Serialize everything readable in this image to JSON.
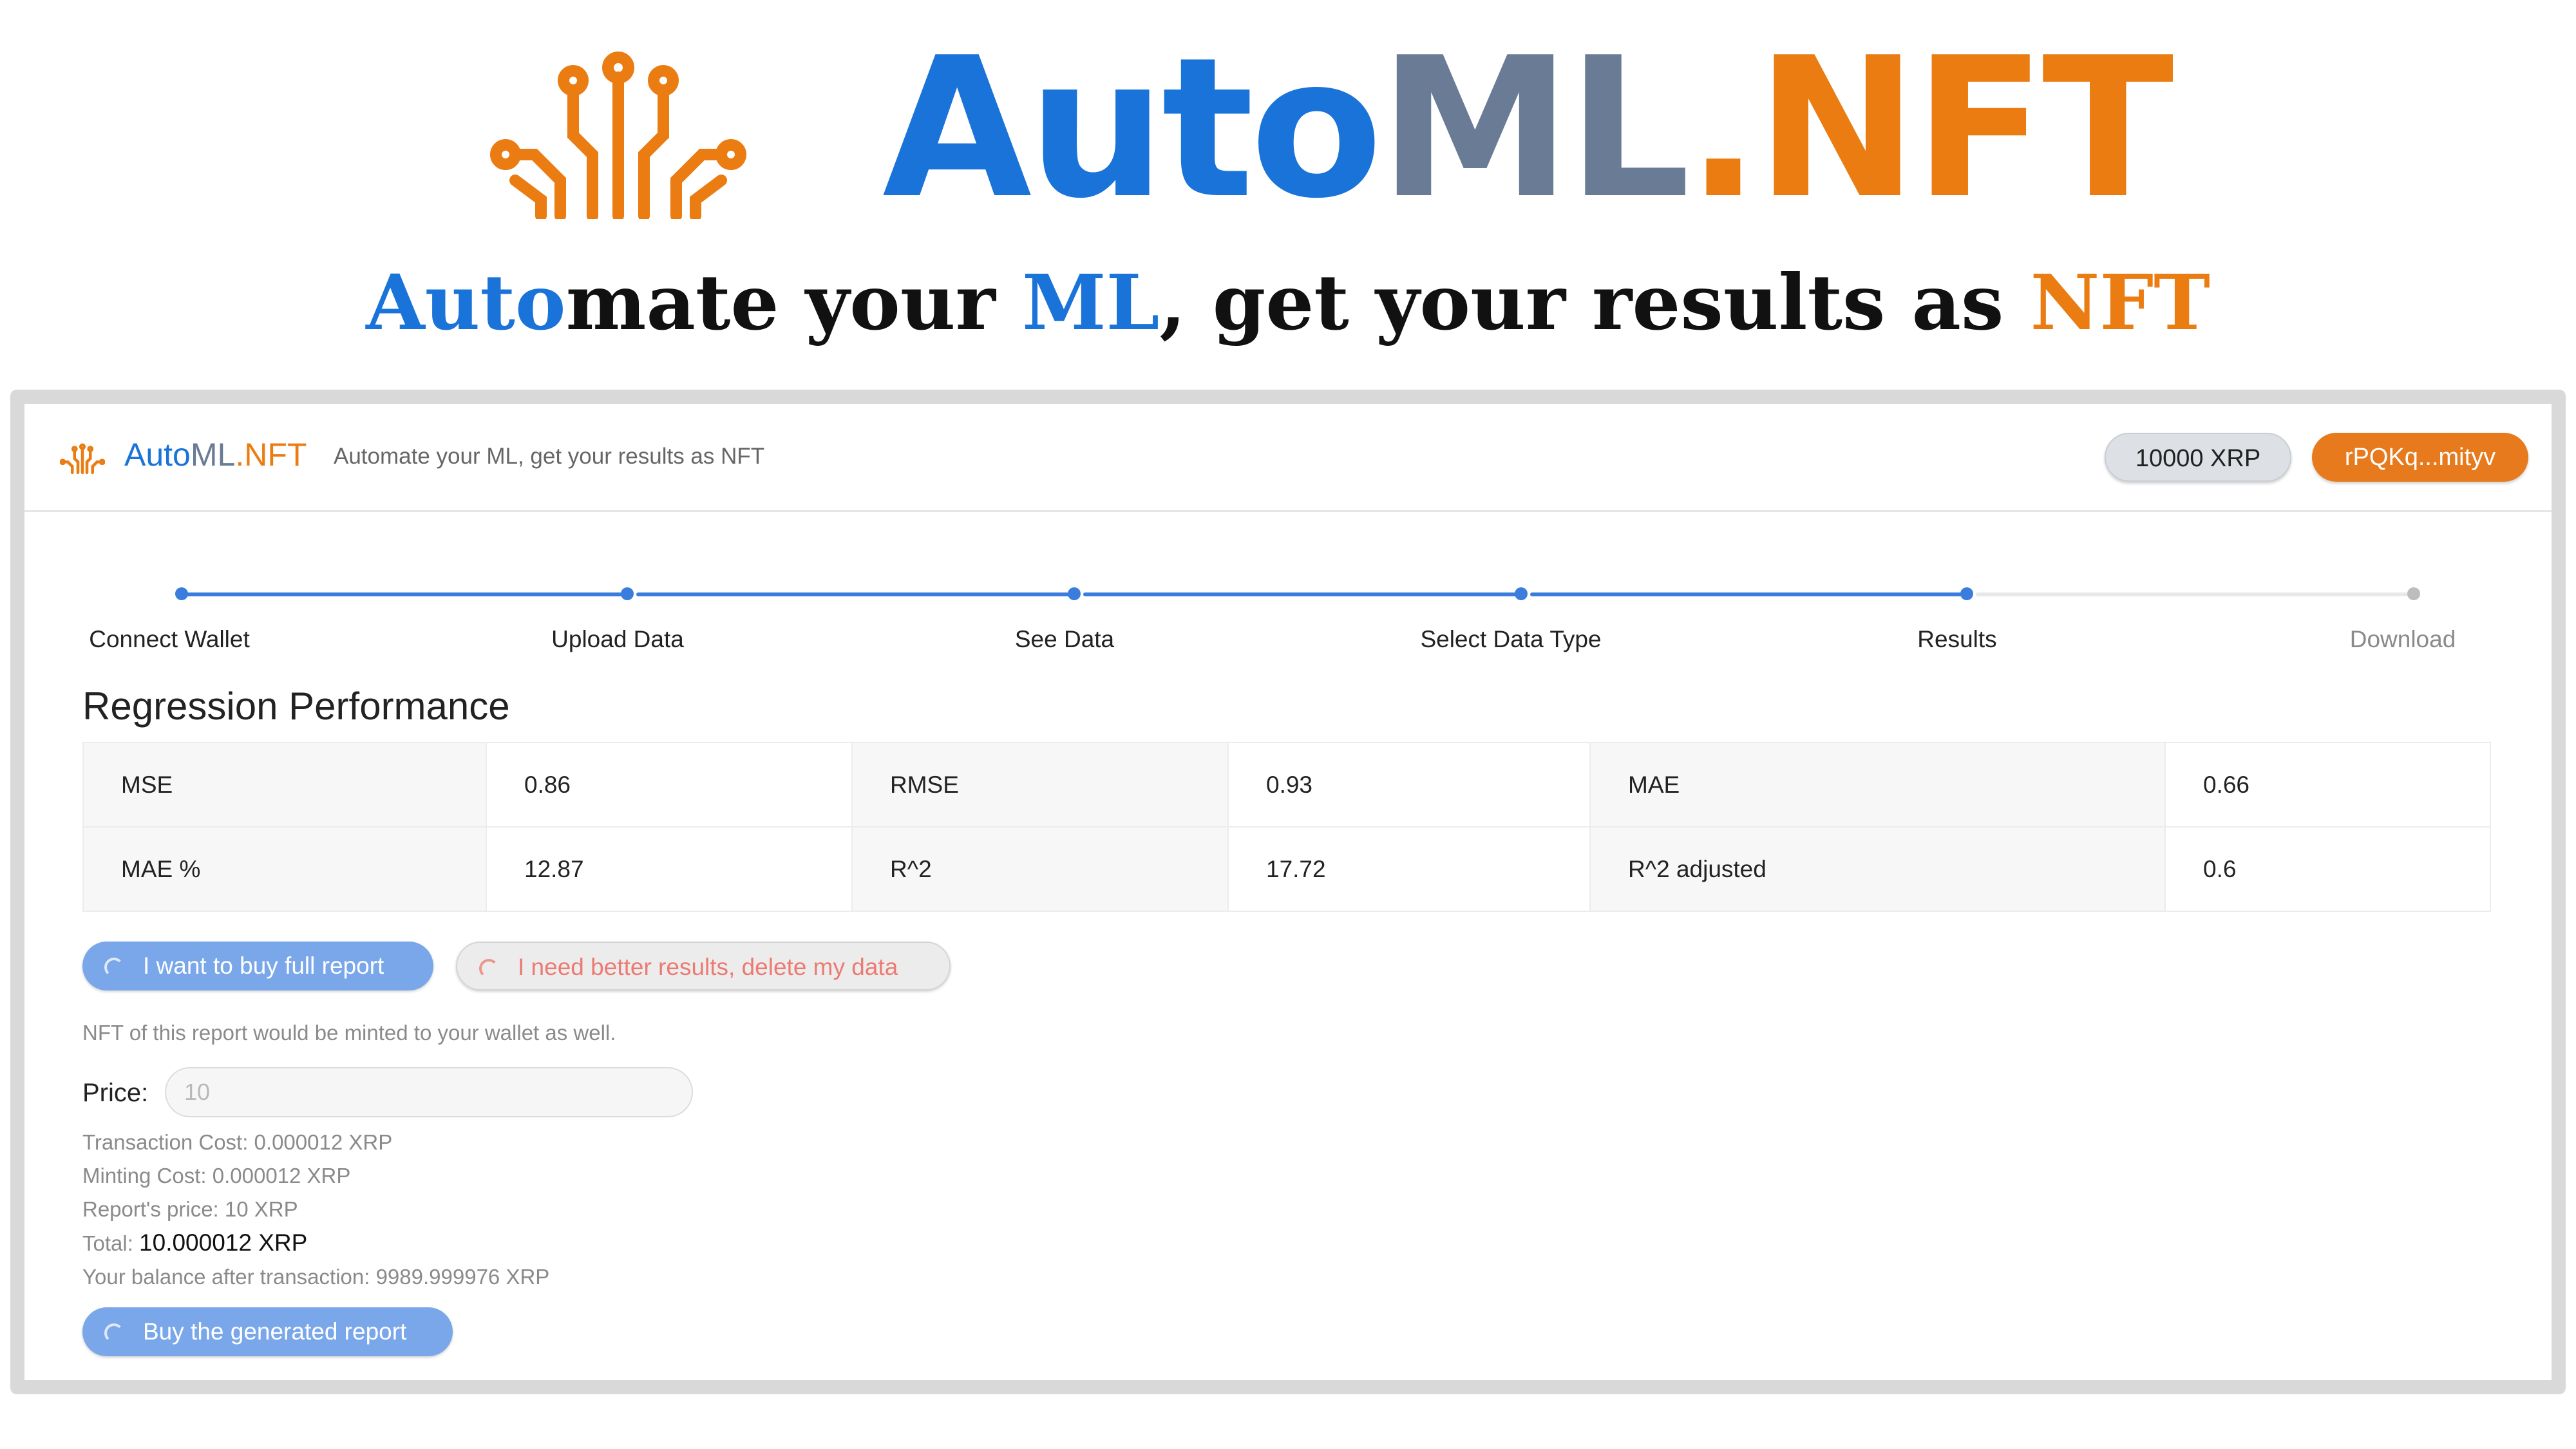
{
  "hero": {
    "title_auto": "Auto",
    "title_ml": "ML",
    "title_nft": ".NFT",
    "tagline_auto": "Auto",
    "tagline_mid1": "mate your ",
    "tagline_ml": "ML",
    "tagline_mid2": ", get your results as ",
    "tagline_nft": "NFT",
    "logo_icon": "circuit-logo-icon"
  },
  "navbar": {
    "brand_auto": "Auto",
    "brand_ml": "ML",
    "brand_nft": ".NFT",
    "tagline": "Automate your ML, get your results as NFT",
    "balance": "10000 XRP",
    "wallet": "rPQKq...mityv"
  },
  "steps": [
    {
      "label": "Connect Wallet",
      "done": true
    },
    {
      "label": "Upload Data",
      "done": true
    },
    {
      "label": "See Data",
      "done": true
    },
    {
      "label": "Select Data Type",
      "done": true
    },
    {
      "label": "Results",
      "done": true
    },
    {
      "label": "Download",
      "done": false
    }
  ],
  "section": {
    "title": "Regression Performance"
  },
  "metrics": [
    [
      {
        "k": "MSE",
        "v": "0.86"
      },
      {
        "k": "RMSE",
        "v": "0.93"
      },
      {
        "k": "MAE",
        "v": "0.66"
      }
    ],
    [
      {
        "k": "MAE %",
        "v": "12.87"
      },
      {
        "k": "R^2",
        "v": "17.72"
      },
      {
        "k": "R^2 adjusted",
        "v": "0.6"
      }
    ]
  ],
  "actions": {
    "buy_full": "I want to buy full report",
    "delete_data": "I need better results, delete my data"
  },
  "purchase": {
    "nft_note": "NFT of this report would be minted to your wallet as well.",
    "price_label": "Price:",
    "price_placeholder": "10",
    "transaction_cost": "Transaction Cost: 0.000012 XRP",
    "minting_cost": "Minting Cost: 0.000012 XRP",
    "report_price": "Report's price: 10 XRP",
    "total_label": "Total: ",
    "total_value": "10.000012 XRP",
    "balance_after": "Your balance after transaction: 9989.999976 XRP",
    "buy_button": "Buy the generated report"
  },
  "colors": {
    "brand_blue": "#1a73d8",
    "brand_orange": "#ea7c12",
    "step_active": "#3b7ddd",
    "primary_button": "#7aa7ea",
    "danger_text": "#ec7a72"
  }
}
